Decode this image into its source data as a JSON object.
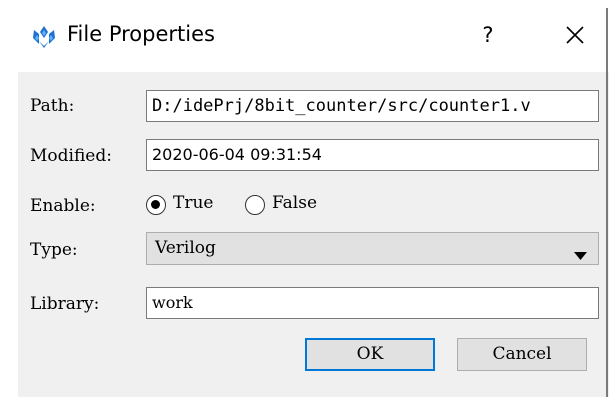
{
  "window": {
    "title": "File Properties",
    "help_label": "?",
    "app_icon": "gowin-logo-icon",
    "close_icon": "close-icon"
  },
  "form": {
    "path": {
      "label": "Path:",
      "value": "D:/idePrj/8bit_counter/src/counter1.v"
    },
    "modified": {
      "label": "Modified:",
      "value": "2020-06-04 09:31:54"
    },
    "enable": {
      "label": "Enable:",
      "options": [
        {
          "label": "True",
          "selected": true
        },
        {
          "label": "False",
          "selected": false
        }
      ]
    },
    "type": {
      "label": "Type:",
      "value": "Verilog",
      "icon": "dropdown-arrow-icon"
    },
    "library": {
      "label": "Library:",
      "value": "work"
    }
  },
  "buttons": {
    "ok": "OK",
    "cancel": "Cancel"
  },
  "colors": {
    "dialog_bg": "#f0f0f0",
    "focus_border": "#0078d7",
    "logo_blue": "#1e6fd0"
  }
}
